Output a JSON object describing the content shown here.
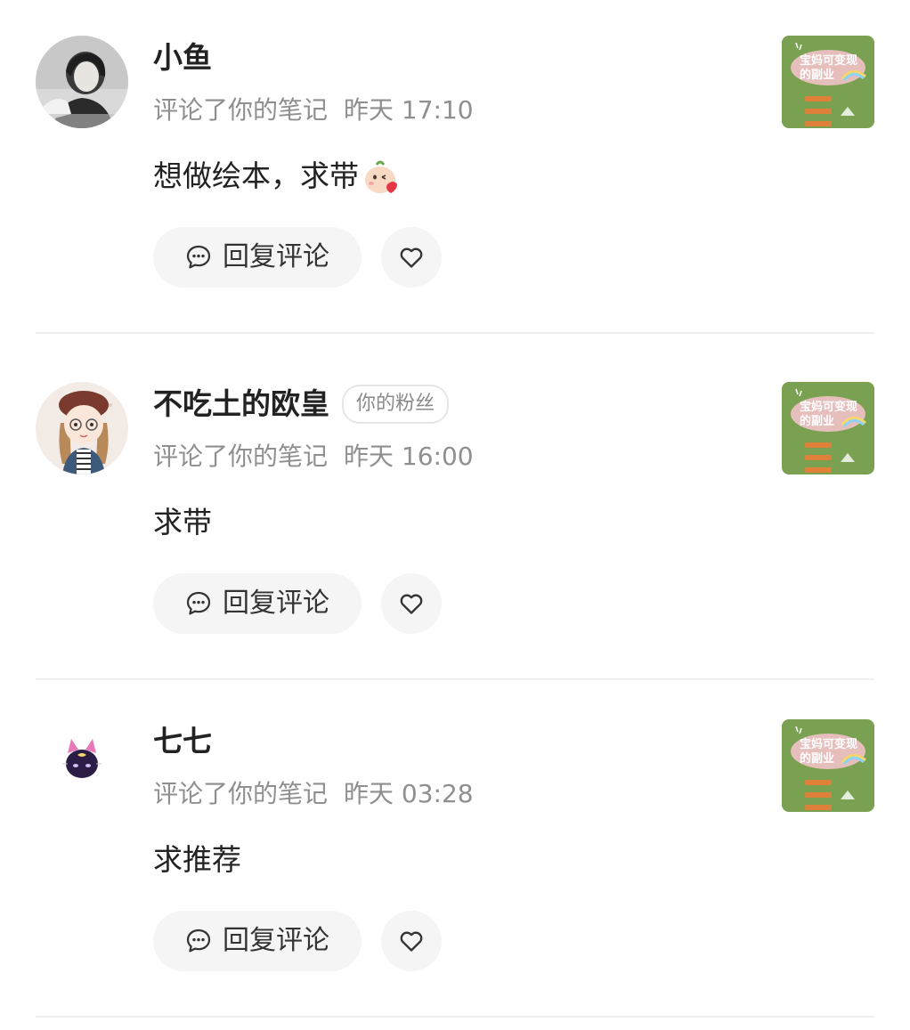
{
  "comments": [
    {
      "username": "小鱼",
      "fan_badge": "",
      "action": "评论了你的笔记",
      "time": "昨天 17:10",
      "text": "想做绘本，求带",
      "emoji_icon": "kiss-face-emoji-icon",
      "reply_label": "回复评论",
      "avatar_icon": "bw-photo-avatar"
    },
    {
      "username": "不吃土的欧皇",
      "fan_badge": "你的粉丝",
      "action": "评论了你的笔记",
      "time": "昨天 16:00",
      "text": "求带",
      "emoji_icon": "",
      "reply_label": "回复评论",
      "avatar_icon": "cartoon-girl-avatar"
    },
    {
      "username": "七七",
      "fan_badge": "",
      "action": "评论了你的笔记",
      "time": "昨天 03:28",
      "text": "求推荐",
      "emoji_icon": "",
      "reply_label": "回复评论",
      "avatar_icon": "purple-cat-avatar"
    }
  ],
  "note_thumbnail": {
    "title_line1": "宝妈可变现",
    "title_line2": "的副业",
    "bg_color": "#7aa152",
    "accent_color": "#f2c1c8",
    "label_color": "#e0813a"
  },
  "colors": {
    "name": "#222222",
    "meta": "#8f8f8f",
    "button_bg": "#f5f5f5",
    "divider": "#efefef"
  }
}
